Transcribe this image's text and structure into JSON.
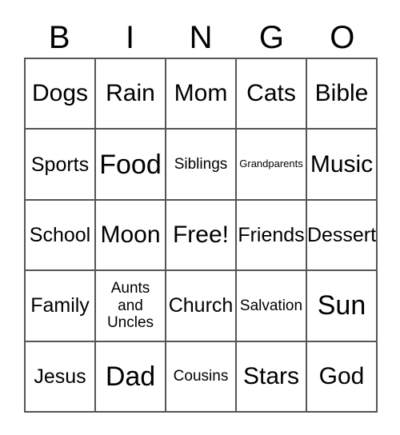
{
  "card": {
    "header_letters": [
      "B",
      "I",
      "N",
      "G",
      "O"
    ],
    "rows": [
      [
        {
          "text": "Dogs",
          "size": "lg"
        },
        {
          "text": "Rain",
          "size": "lg"
        },
        {
          "text": "Mom",
          "size": "lg"
        },
        {
          "text": "Cats",
          "size": "lg"
        },
        {
          "text": "Bible",
          "size": "lg"
        }
      ],
      [
        {
          "text": "Sports",
          "size": "md"
        },
        {
          "text": "Food",
          "size": "xl"
        },
        {
          "text": "Siblings",
          "size": "sm"
        },
        {
          "text": "Grandparents",
          "size": "xs"
        },
        {
          "text": "Music",
          "size": "lg"
        }
      ],
      [
        {
          "text": "School",
          "size": "md"
        },
        {
          "text": "Moon",
          "size": "lg"
        },
        {
          "text": "Free!",
          "size": "lg"
        },
        {
          "text": "Friends",
          "size": "md"
        },
        {
          "text": "Dessert",
          "size": "md"
        }
      ],
      [
        {
          "text": "Family",
          "size": "md"
        },
        {
          "text": "Aunts and Uncles",
          "size": "wrap"
        },
        {
          "text": "Church",
          "size": "md"
        },
        {
          "text": "Salvation",
          "size": "sm"
        },
        {
          "text": "Sun",
          "size": "xl"
        }
      ],
      [
        {
          "text": "Jesus",
          "size": "md"
        },
        {
          "text": "Dad",
          "size": "xl"
        },
        {
          "text": "Cousins",
          "size": "sm"
        },
        {
          "text": "Stars",
          "size": "lg"
        },
        {
          "text": "God",
          "size": "lg"
        }
      ]
    ]
  },
  "colors": {
    "border": "#555555",
    "text": "#000000",
    "background": "#ffffff"
  }
}
